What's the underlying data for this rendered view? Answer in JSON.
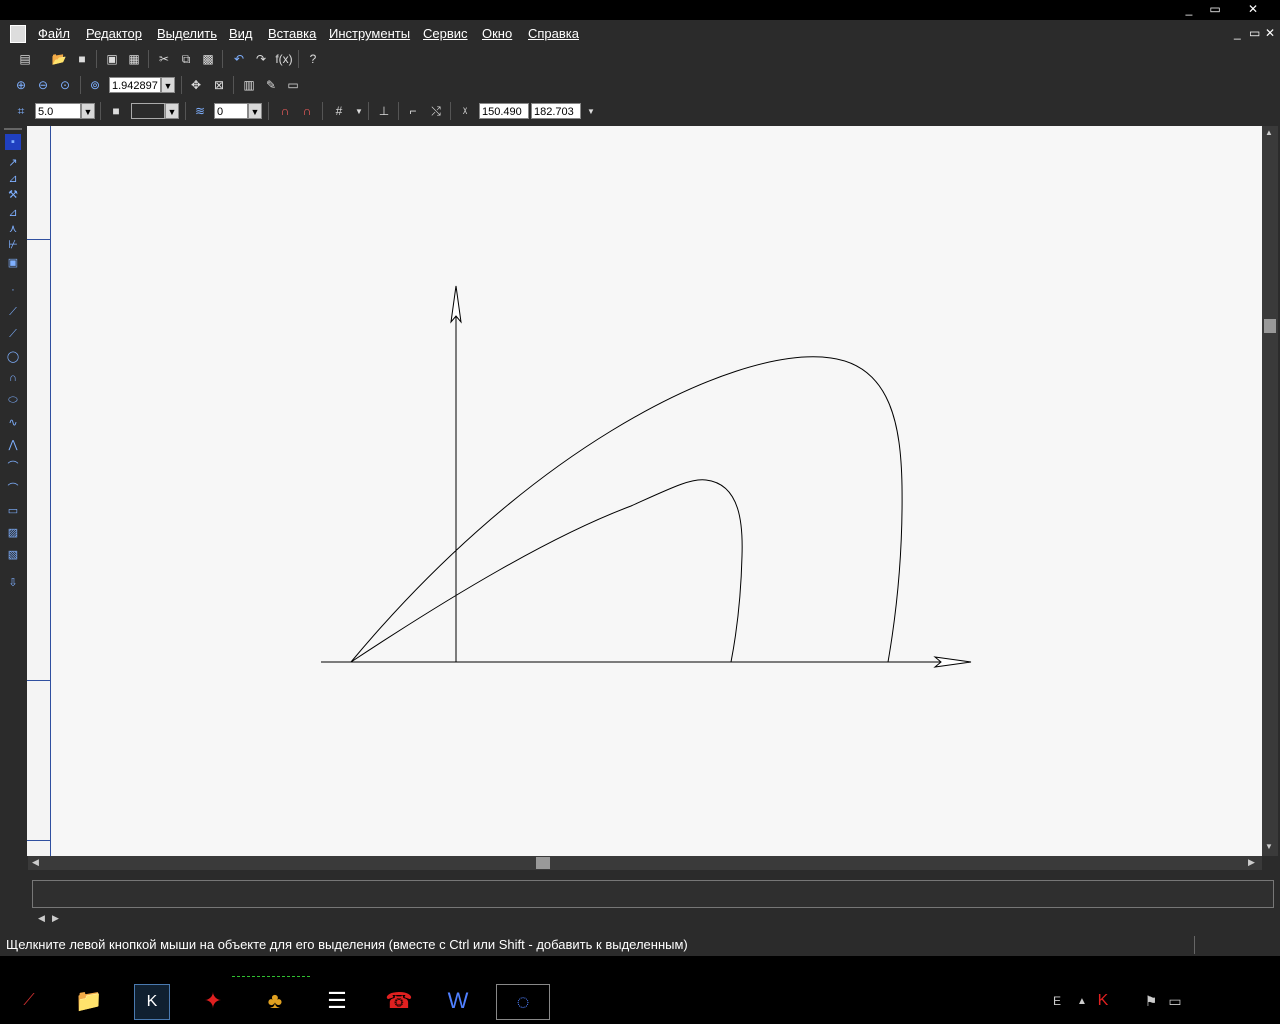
{
  "window": {
    "minimize": "_",
    "restore": "▭",
    "close": "✕"
  },
  "menu": {
    "items": [
      "Файл",
      "Редактор",
      "Выделить",
      "Вид",
      "Вставка",
      "Инструменты",
      "Сервис",
      "Окно",
      "Справка"
    ],
    "mdi_minimize": "_",
    "mdi_restore": "▭",
    "mdi_close": "✕"
  },
  "toolbar_view": {
    "zoom_value": "1.942897"
  },
  "toolbar_props": {
    "step_value": "5.0",
    "style_value": "",
    "layer_value": "0",
    "coord_x": "150.490",
    "coord_y": "182.703"
  },
  "status": {
    "hint": "Щелкните левой кнопкой мыши на объекте для его выделения (вместе с Ctrl или Shift - добавить к выделенным)"
  },
  "colors": {
    "canvas": "#f7f7f7",
    "chrome": "#2b2b2b",
    "accent": "#3050a0"
  },
  "icons": {
    "toolbar_standard": [
      "new-doc-icon",
      "open-icon",
      "save-icon",
      "print-icon",
      "preview-icon",
      "cut-icon",
      "copy-icon",
      "paste-icon",
      "undo-icon",
      "redo-icon",
      "formula-icon",
      "help-icon"
    ],
    "toolbar_view": [
      "zoom-in-icon",
      "zoom-out-icon",
      "zoom-window-icon",
      "zoom-icon",
      "pan-icon",
      "fit-icon",
      "refresh-icon",
      "layers-icon",
      "display-icon"
    ],
    "taskbar": [
      "start-icon",
      "explorer-icon",
      "kompas-icon",
      "bird-icon",
      "app-icon",
      "notepad-icon",
      "phone-icon",
      "word-icon",
      "network-icon"
    ]
  }
}
